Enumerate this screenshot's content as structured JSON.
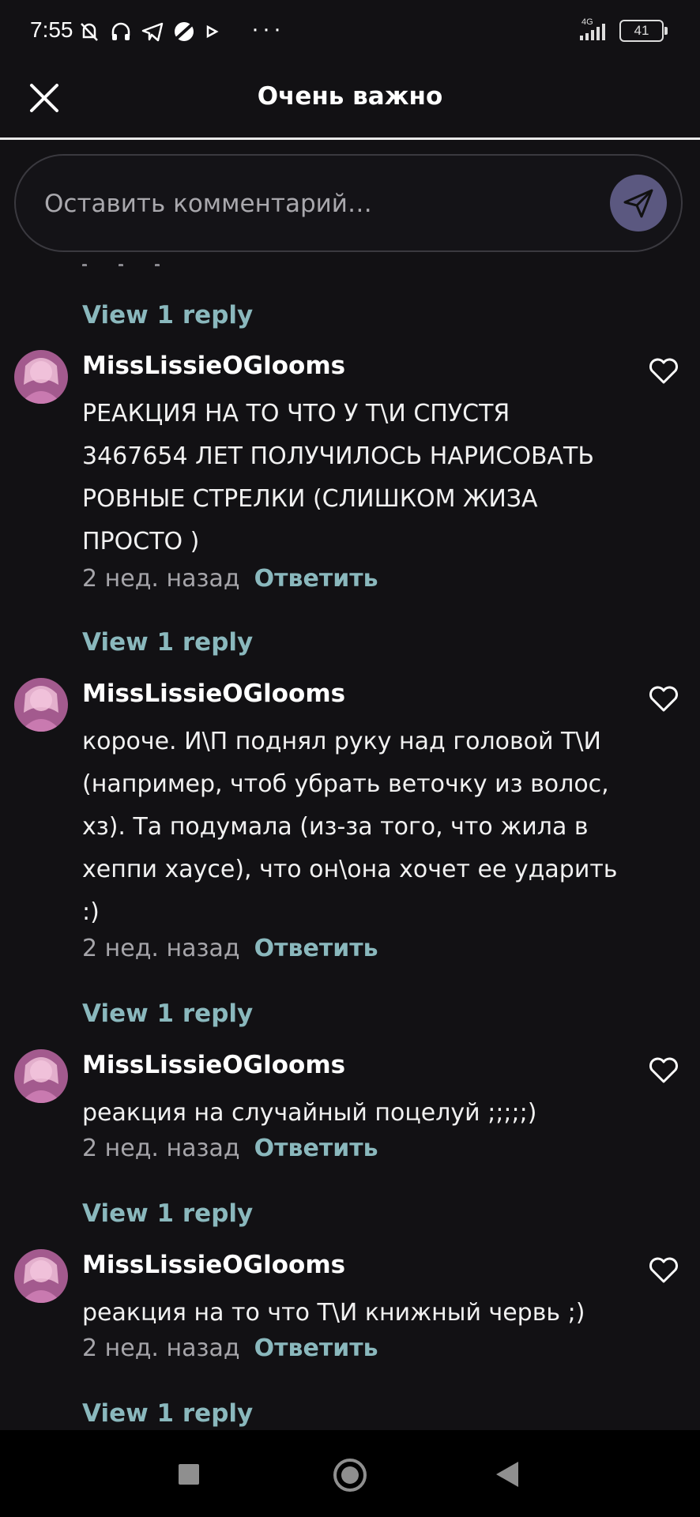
{
  "status_bar": {
    "time": "7:55",
    "network": "4G",
    "battery": "41",
    "more": "···"
  },
  "header": {
    "title": "Очень важно",
    "close_icon": "close-icon"
  },
  "comment_input": {
    "placeholder": "Оставить комментарий…",
    "send_icon": "send-icon",
    "send_color": "#5b5880"
  },
  "colors": {
    "background": "#121114",
    "accent": "#8ab8bd",
    "muted": "#a6a5aa"
  },
  "comments": [
    {
      "view_reply": "View 1 reply"
    },
    {
      "author": "MissLissieOGlooms",
      "text": "РЕАКЦИЯ НА ТО ЧТО У Т\\И СПУСТЯ 3467654 ЛЕТ ПОЛУЧИЛОСЬ НАРИСОВАТЬ РОВНЫЕ СТРЕЛКИ (СЛИШКОМ ЖИЗА ПРОСТО )",
      "time": "2 нед. назад",
      "reply": "Ответить",
      "view_reply": "View 1 reply"
    },
    {
      "author": "MissLissieOGlooms",
      "text": "короче. И\\П поднял руку над головой Т\\И (например, чтоб убрать веточку из волос, хз). Та подумала (из-за того, что жила в хеппи хаусе), что он\\она хочет ее ударить :)",
      "time": "2 нед. назад",
      "reply": "Ответить",
      "view_reply": "View 1 reply"
    },
    {
      "author": "MissLissieOGlooms",
      "text": "реакция на случайный поцелуй ;;;;;)",
      "time": "2 нед. назад",
      "reply": "Ответить",
      "view_reply": "View 1 reply"
    },
    {
      "author": "MissLissieOGlooms",
      "text": "реакция на то что Т\\И книжный червь ;)",
      "time": "2 нед. назад",
      "reply": "Ответить",
      "view_reply": "View 1 reply"
    }
  ]
}
